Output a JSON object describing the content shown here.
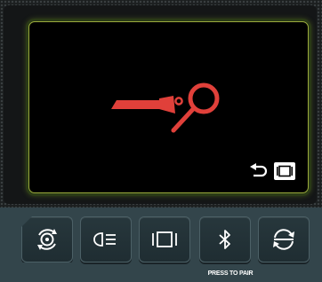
{
  "display": {
    "main_icon": "pedal-magnifier-icon",
    "corner_icons": [
      "return-arrow-icon",
      "view-frame-icon"
    ],
    "accent_color": "#e0403a",
    "border_color": "#9aab3c"
  },
  "buttons": [
    {
      "icon": "tire-rotate-icon"
    },
    {
      "icon": "headlight-icon"
    },
    {
      "icon": "display-frame-icon"
    },
    {
      "icon": "bluetooth-icon"
    },
    {
      "icon": "sync-icon"
    }
  ],
  "caption": "PRESS TO PAIR"
}
